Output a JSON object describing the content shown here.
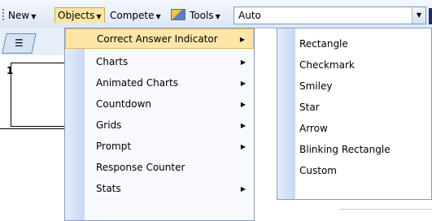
{
  "toolbar": {
    "new_label": "New",
    "objects_label": "Objects",
    "compete_label": "Compete",
    "tools_label": "Tools",
    "combo_value": "Auto"
  },
  "slides": {
    "first_number": "1"
  },
  "objects_menu": {
    "items": [
      {
        "label": "Correct Answer Indicator",
        "submenu": true,
        "highlighted": true
      },
      {
        "label": "Charts",
        "submenu": true
      },
      {
        "label": "Animated Charts",
        "submenu": true
      },
      {
        "label": "Countdown",
        "submenu": true
      },
      {
        "label": "Grids",
        "submenu": true
      },
      {
        "label": "Prompt",
        "submenu": true
      },
      {
        "label": "Response Counter",
        "submenu": false
      },
      {
        "label": "Stats",
        "submenu": true
      }
    ]
  },
  "indicator_submenu": {
    "items": [
      {
        "label": "Rectangle"
      },
      {
        "label": "Checkmark"
      },
      {
        "label": "Smiley"
      },
      {
        "label": "Star"
      },
      {
        "label": "Arrow"
      },
      {
        "label": "Blinking Rectangle"
      },
      {
        "label": "Custom"
      }
    ]
  }
}
